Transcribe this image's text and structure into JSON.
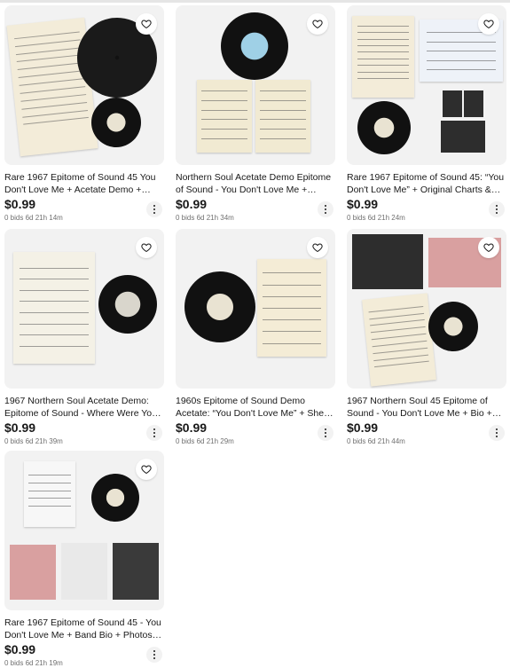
{
  "icons": {
    "heart": "heart-icon",
    "more": "more-options-icon"
  },
  "colors": {
    "text": "#191919",
    "muted": "#707070",
    "card_bg": "#f2f2f2"
  },
  "listings": [
    {
      "title": "Rare 1967 Epitome of Sound 45 You Don't Love Me + Acetate Demo + Sheet Music",
      "price": "$0.99",
      "bids": "0 bids",
      "time": "6d 21h 14m"
    },
    {
      "title": "Northern Soul Acetate Demo Epitome of Sound - You Don't Love Me + Sheet Music",
      "price": "$0.99",
      "bids": "0 bids",
      "time": "6d 21h 34m"
    },
    {
      "title": "Rare 1967 Epitome of Sound 45: “You Don't Love Me” + Original Charts & Photos",
      "price": "$0.99",
      "bids": "0 bids",
      "time": "6d 21h 24m"
    },
    {
      "title": "1967 Northern Soul Acetate Demo: Epitome of Sound - Where Were You When I Needed You",
      "price": "$0.99",
      "bids": "0 bids",
      "time": "6d 21h 39m"
    },
    {
      "title": "1960s Epitome of Sound Demo Acetate: “You Don't Love Me” + Sheet Music",
      "price": "$0.99",
      "bids": "0 bids",
      "time": "6d 21h 29m"
    },
    {
      "title": "1967 Northern Soul 45 Epitome of Sound - You Don't Love Me + Bio + Photos",
      "price": "$0.99",
      "bids": "0 bids",
      "time": "6d 21h 44m"
    },
    {
      "title": "Rare 1967 Epitome of Sound 45 - You Don't Love Me + Band Bio + Photos + Lyrics",
      "price": "$0.99",
      "bids": "0 bids",
      "time": "6d 21h 19m"
    }
  ]
}
